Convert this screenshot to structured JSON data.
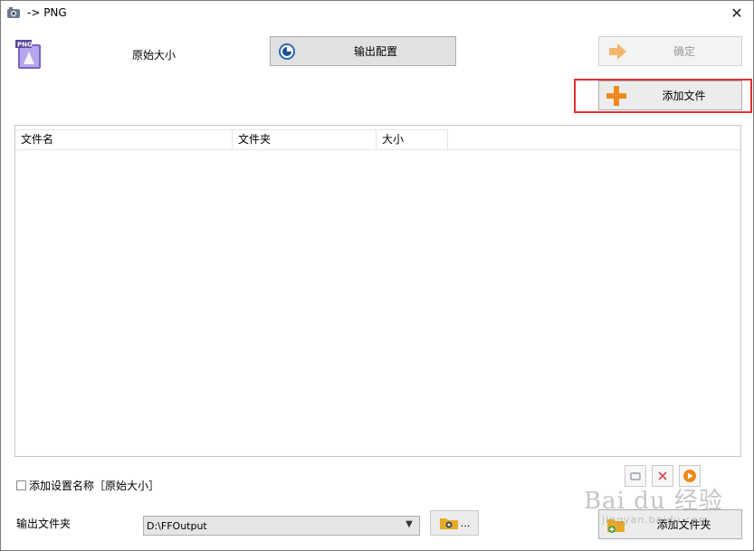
{
  "window": {
    "title": "-> PNG",
    "close_glyph": "✕",
    "app_icon": "format-factory-icon"
  },
  "header": {
    "preset_icon": "png-file-icon",
    "preset_label": "原始大小",
    "output_config_label": "输出配置",
    "ok_label": "确定",
    "add_file_label": "添加文件"
  },
  "file_list": {
    "columns": [
      "文件名",
      "文件夹",
      "大小"
    ],
    "rows": []
  },
  "footer": {
    "add_setting_name_label": "添加设置名称［原始大小］",
    "add_setting_name_checked": false,
    "output_folder_label": "输出文件夹",
    "output_folder_value": "D:\\FFOutput",
    "browse_ellipsis": "...",
    "add_folder_label": "添加文件夹"
  },
  "watermark": {
    "main": "Bai du 经验",
    "sub": "jingyan.baidu.com"
  },
  "colors": {
    "highlight": "#e03030",
    "plus_orange": "#f08a1c",
    "arrow_orange": "#f5b46e"
  }
}
